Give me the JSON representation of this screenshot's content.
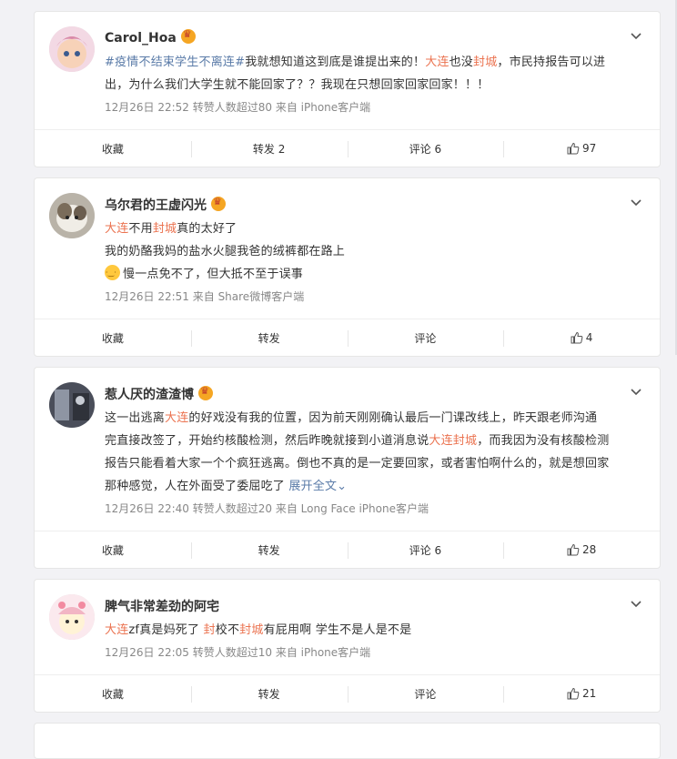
{
  "posts": [
    {
      "username": "Carol_Hoa",
      "lines": [
        [
          {
            "t": "#疫情不结束学生不离连#",
            "c": "hashtag"
          },
          {
            "t": "我就想知道这到底是谁提出来的！",
            "c": ""
          },
          {
            "t": "大连",
            "c": "tag"
          },
          {
            "t": "也没",
            "c": ""
          },
          {
            "t": "封城",
            "c": "tag"
          },
          {
            "t": "，市民持报告可以进",
            "c": ""
          }
        ],
        [
          {
            "t": "出，为什么我们大学生就不能回家了？？我现在只想回家回家回家！！！",
            "c": ""
          }
        ]
      ],
      "meta": "12月26日 22:52 转赞人数超过80 来自 iPhone客户端",
      "actions": {
        "favorite": "收藏",
        "repost": "转发 2",
        "comment": "评论 6",
        "like": "97"
      }
    },
    {
      "username": "乌尔君的王虚闪光",
      "lines": [
        [
          {
            "t": "大连",
            "c": "tag"
          },
          {
            "t": "不用",
            "c": ""
          },
          {
            "t": "封城",
            "c": "tag"
          },
          {
            "t": "真的太好了",
            "c": ""
          }
        ],
        [
          {
            "t": "我的奶酪我妈的盐水火腿我爸的绒裤都在路上",
            "c": ""
          }
        ],
        [
          {
            "t": "",
            "c": "emoji"
          },
          {
            "t": "慢一点免不了，但大抵不至于误事",
            "c": ""
          }
        ]
      ],
      "meta": "12月26日 22:51 来自 Share微博客户端",
      "actions": {
        "favorite": "收藏",
        "repost": "转发",
        "comment": "评论",
        "like": "4"
      }
    },
    {
      "username": "惹人厌的渣渣博",
      "lines": [
        [
          {
            "t": "这一出逃离",
            "c": ""
          },
          {
            "t": "大连",
            "c": "tag"
          },
          {
            "t": "的好戏没有我的位置，因为前天刚刚确认最后一门课改线上，昨天跟老师沟通",
            "c": ""
          }
        ],
        [
          {
            "t": "完直接改签了，开始约核酸检测，然后昨晚就接到小道消息说",
            "c": ""
          },
          {
            "t": "大连封城",
            "c": "tag"
          },
          {
            "t": "，而我因为没有核酸检测",
            "c": ""
          }
        ],
        [
          {
            "t": "报告只能看着大家一个个疯狂逃离。倒也不真的是一定要回家，或者害怕啊什么的，就是想回家",
            "c": ""
          }
        ],
        [
          {
            "t": "那种感觉，人在外面受了委屈吃了 ",
            "c": ""
          },
          {
            "t": "展开全文",
            "c": "more"
          },
          {
            "t": "⌄",
            "c": "more"
          }
        ]
      ],
      "meta": "12月26日 22:40 转赞人数超过20 来自 Long Face iPhone客户端",
      "actions": {
        "favorite": "收藏",
        "repost": "转发",
        "comment": "评论 6",
        "like": "28"
      }
    },
    {
      "username": "脾气非常差劲的阿宅",
      "lines": [
        [
          {
            "t": "大连",
            "c": "tag"
          },
          {
            "t": "zf真是妈死了 ",
            "c": ""
          },
          {
            "t": "封",
            "c": "tag"
          },
          {
            "t": "校不",
            "c": ""
          },
          {
            "t": "封城",
            "c": "tag"
          },
          {
            "t": "有屁用啊 学生不是人是不是",
            "c": ""
          }
        ]
      ],
      "meta": "12月26日 22:05 转赞人数超过10 来自 iPhone客户端",
      "actions": {
        "favorite": "收藏",
        "repost": "转发",
        "comment": "评论",
        "like": "21"
      }
    }
  ],
  "colors": {
    "tag": "#eb7350",
    "hashtag": "#5a7ba8",
    "meta": "#888888"
  }
}
